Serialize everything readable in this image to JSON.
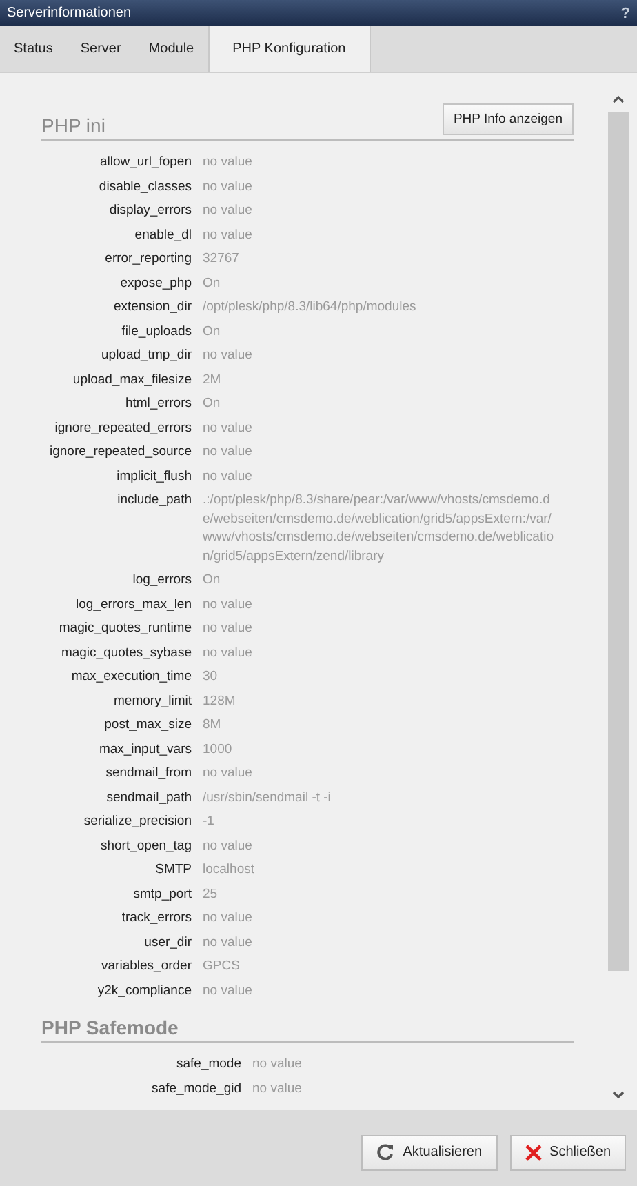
{
  "window": {
    "title": "Serverinformationen",
    "help": "?"
  },
  "tabs": [
    {
      "label": "Status",
      "selected": false
    },
    {
      "label": "Server",
      "selected": false
    },
    {
      "label": "Module",
      "selected": false
    },
    {
      "label": "PHP Konfiguration",
      "selected": true
    }
  ],
  "sections": [
    {
      "title": "PHP ini",
      "button": "PHP Info anzeigen",
      "rows": [
        {
          "key": "allow_url_fopen",
          "value": "no value"
        },
        {
          "key": "disable_classes",
          "value": "no value"
        },
        {
          "key": "display_errors",
          "value": "no value"
        },
        {
          "key": "enable_dl",
          "value": "no value"
        },
        {
          "key": "error_reporting",
          "value": "32767"
        },
        {
          "key": "expose_php",
          "value": "On"
        },
        {
          "key": "extension_dir",
          "value": "/opt/plesk/php/8.3/lib64/php/modules"
        },
        {
          "key": "file_uploads",
          "value": "On"
        },
        {
          "key": "upload_tmp_dir",
          "value": "no value"
        },
        {
          "key": "upload_max_filesize",
          "value": "2M"
        },
        {
          "key": "html_errors",
          "value": "On"
        },
        {
          "key": "ignore_repeated_errors",
          "value": "no value"
        },
        {
          "key": "ignore_repeated_source",
          "value": "no value"
        },
        {
          "key": "implicit_flush",
          "value": "no value"
        },
        {
          "key": "include_path",
          "value": ".:/opt/plesk/php/8.3/share/pear:/var/www/vhosts/cmsdemo.de/webseiten/cmsdemo.de/weblication/grid5/appsExtern:/var/www/vhosts/cmsdemo.de/webseiten/cmsdemo.de/weblication/grid5/appsExtern/zend/library"
        },
        {
          "key": "log_errors",
          "value": "On"
        },
        {
          "key": "log_errors_max_len",
          "value": "no value"
        },
        {
          "key": "magic_quotes_runtime",
          "value": "no value"
        },
        {
          "key": "magic_quotes_sybase",
          "value": "no value"
        },
        {
          "key": "max_execution_time",
          "value": "30"
        },
        {
          "key": "memory_limit",
          "value": "128M"
        },
        {
          "key": "post_max_size",
          "value": "8M"
        },
        {
          "key": "max_input_vars",
          "value": "1000"
        },
        {
          "key": "sendmail_from",
          "value": "no value"
        },
        {
          "key": "sendmail_path",
          "value": "/usr/sbin/sendmail -t -i"
        },
        {
          "key": "serialize_precision",
          "value": "-1"
        },
        {
          "key": "short_open_tag",
          "value": "no value"
        },
        {
          "key": "SMTP",
          "value": "localhost"
        },
        {
          "key": "smtp_port",
          "value": "25"
        },
        {
          "key": "track_errors",
          "value": "no value"
        },
        {
          "key": "user_dir",
          "value": "no value"
        },
        {
          "key": "variables_order",
          "value": "GPCS"
        },
        {
          "key": "y2k_compliance",
          "value": "no value"
        }
      ]
    },
    {
      "title": "PHP Safemode",
      "rows": [
        {
          "key": "safe_mode",
          "value": "no value"
        },
        {
          "key": "safe_mode_gid",
          "value": "no value"
        }
      ]
    }
  ],
  "footer": {
    "buttons": [
      {
        "kind": "refresh",
        "label": "Aktualisieren"
      },
      {
        "kind": "close",
        "label": "Schließen"
      }
    ]
  }
}
